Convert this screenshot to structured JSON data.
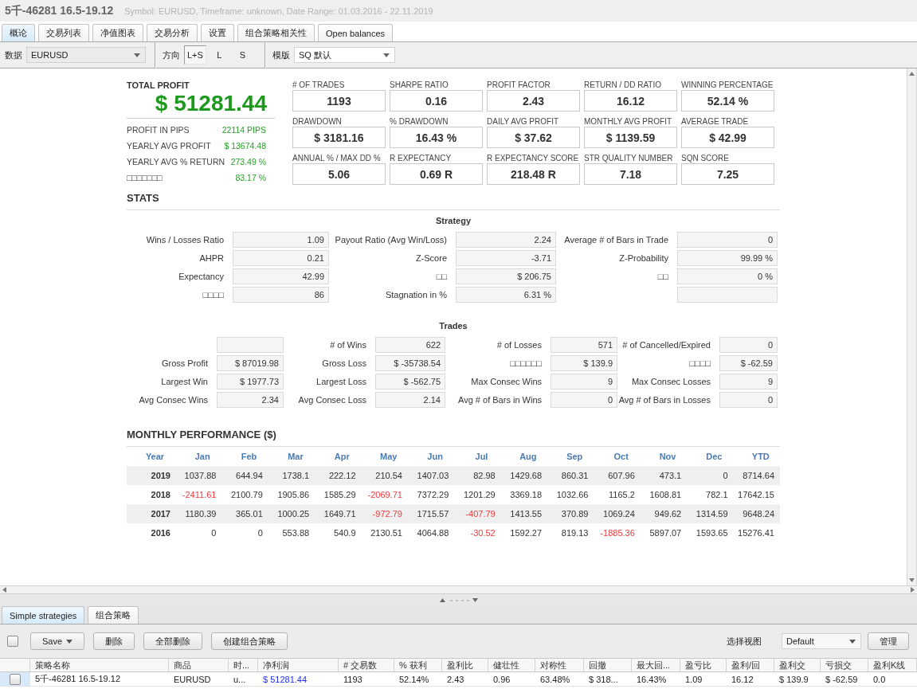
{
  "window": {
    "title": "5千-46281 16.5-19.12",
    "subtitle": "Symbol: EURUSD, Timeframe: unknown, Date Range: 01.03.2016 - 22.11.2019"
  },
  "tabs": [
    {
      "label": "概论",
      "selected": true
    },
    {
      "label": "交易列表",
      "selected": false
    },
    {
      "label": "净值图表",
      "selected": false
    },
    {
      "label": "交易分析",
      "selected": false
    },
    {
      "label": "设置",
      "selected": false
    },
    {
      "label": "组合策略相关性",
      "selected": false
    },
    {
      "label": "Open balances",
      "selected": false
    }
  ],
  "toolbar": {
    "data_label": "数据",
    "data_value": "EURUSD",
    "direction_label": "方向",
    "directions": [
      {
        "label": "L+S",
        "selected": true
      },
      {
        "label": "L",
        "selected": false
      },
      {
        "label": "S",
        "selected": false
      }
    ],
    "template_label": "模版",
    "template_value": "SQ 默认"
  },
  "summary": {
    "total_profit_label": "TOTAL PROFIT",
    "total_profit": "$ 51281.44",
    "details": [
      {
        "label": "PROFIT IN PIPS",
        "value": "22114 PIPS"
      },
      {
        "label": "YEARLY AVG PROFIT",
        "value": "$ 13674.48"
      },
      {
        "label": "YEARLY AVG % RETURN",
        "value": "273.49 %"
      },
      {
        "label": "□□□□□□□",
        "value": "83.17 %"
      }
    ]
  },
  "metrics": [
    {
      "label": "# OF TRADES",
      "value": "1193"
    },
    {
      "label": "SHARPE RATIO",
      "value": "0.16"
    },
    {
      "label": "PROFIT FACTOR",
      "value": "2.43"
    },
    {
      "label": "RETURN / DD RATIO",
      "value": "16.12"
    },
    {
      "label": "WINNING PERCENTAGE",
      "value": "52.14 %"
    },
    {
      "label": "DRAWDOWN",
      "value": "$ 3181.16"
    },
    {
      "label": "% DRAWDOWN",
      "value": "16.43 %"
    },
    {
      "label": "DAILY AVG PROFIT",
      "value": "$ 37.62"
    },
    {
      "label": "MONTHLY AVG PROFIT",
      "value": "$ 1139.59"
    },
    {
      "label": "AVERAGE TRADE",
      "value": "$ 42.99"
    },
    {
      "label": "ANNUAL % / MAX DD %",
      "value": "5.06"
    },
    {
      "label": "R EXPECTANCY",
      "value": "0.69 R"
    },
    {
      "label": "R EXPECTANCY SCORE",
      "value": "218.48 R"
    },
    {
      "label": "STR QUALITY NUMBER",
      "value": "7.18"
    },
    {
      "label": "SQN SCORE",
      "value": "7.25"
    }
  ],
  "stats": {
    "title": "STATS",
    "sections": [
      {
        "title": "Strategy",
        "rows": [
          [
            {
              "kind": "field",
              "label": "Wins / Losses Ratio",
              "value": "1.09"
            },
            {
              "kind": "field",
              "label": "Payout Ratio (Avg Win/Loss)",
              "value": "2.24"
            },
            {
              "kind": "field",
              "label": "Average # of Bars in Trade",
              "value": "0"
            }
          ],
          [
            {
              "kind": "field",
              "label": "AHPR",
              "value": "0.21"
            },
            {
              "kind": "field",
              "label": "Z-Score",
              "value": "-3.71"
            },
            {
              "kind": "field",
              "label": "Z-Probability",
              "value": "99.99 %"
            }
          ],
          [
            {
              "kind": "field",
              "label": "Expectancy",
              "value": "42.99"
            },
            {
              "kind": "field",
              "label": "□□",
              "value": "$ 206.75"
            },
            {
              "kind": "field",
              "label": "□□",
              "value": "0 %"
            }
          ],
          [
            {
              "kind": "field",
              "label": "□□□□",
              "value": "86"
            },
            {
              "kind": "field",
              "label": "Stagnation in %",
              "value": "6.31 %"
            },
            {
              "kind": "blank"
            }
          ]
        ]
      },
      {
        "title": "Trades",
        "rows": [
          [
            {
              "kind": "blank"
            },
            {
              "kind": "field",
              "label": "# of Wins",
              "value": "622"
            },
            {
              "kind": "field",
              "label": "# of Losses",
              "value": "571"
            },
            {
              "kind": "field",
              "label": "# of Cancelled/Expired",
              "value": "0"
            }
          ],
          [
            {
              "kind": "field",
              "label": "Gross Profit",
              "value": "$ 87019.98"
            },
            {
              "kind": "field",
              "label": "Gross Loss",
              "value": "$ -35738.54"
            },
            {
              "kind": "field",
              "label": "□□□□□□",
              "value": "$ 139.9"
            },
            {
              "kind": "field",
              "label": "□□□□",
              "value": "$ -62.59"
            }
          ],
          [
            {
              "kind": "field",
              "label": "Largest Win",
              "value": "$ 1977.73"
            },
            {
              "kind": "field",
              "label": "Largest Loss",
              "value": "$ -562.75"
            },
            {
              "kind": "field",
              "label": "Max Consec Wins",
              "value": "9"
            },
            {
              "kind": "field",
              "label": "Max Consec Losses",
              "value": "9"
            }
          ],
          [
            {
              "kind": "field",
              "label": "Avg Consec Wins",
              "value": "2.34"
            },
            {
              "kind": "field",
              "label": "Avg Consec Loss",
              "value": "2.14"
            },
            {
              "kind": "field",
              "label": "Avg # of Bars in Wins",
              "value": "0"
            },
            {
              "kind": "field",
              "label": "Avg # of Bars in Losses",
              "value": "0"
            }
          ]
        ]
      }
    ]
  },
  "monthly": {
    "title": "MONTHLY PERFORMANCE ($)",
    "columns": [
      "Year",
      "Jan",
      "Feb",
      "Mar",
      "Apr",
      "May",
      "Jun",
      "Jul",
      "Aug",
      "Sep",
      "Oct",
      "Nov",
      "Dec",
      "YTD"
    ],
    "rows": [
      {
        "cells": [
          {
            "value": "2019",
            "negative": false
          },
          {
            "value": "1037.88",
            "negative": false
          },
          {
            "value": "644.94",
            "negative": false
          },
          {
            "value": "1738.1",
            "negative": false
          },
          {
            "value": "222.12",
            "negative": false
          },
          {
            "value": "210.54",
            "negative": false
          },
          {
            "value": "1407.03",
            "negative": false
          },
          {
            "value": "82.98",
            "negative": false
          },
          {
            "value": "1429.68",
            "negative": false
          },
          {
            "value": "860.31",
            "negative": false
          },
          {
            "value": "607.96",
            "negative": false
          },
          {
            "value": "473.1",
            "negative": false
          },
          {
            "value": "0",
            "negative": false
          },
          {
            "value": "8714.64",
            "negative": false
          }
        ]
      },
      {
        "cells": [
          {
            "value": "2018",
            "negative": false
          },
          {
            "value": "-2411.61",
            "negative": true
          },
          {
            "value": "2100.79",
            "negative": false
          },
          {
            "value": "1905.86",
            "negative": false
          },
          {
            "value": "1585.29",
            "negative": false
          },
          {
            "value": "-2069.71",
            "negative": true
          },
          {
            "value": "7372.29",
            "negative": false
          },
          {
            "value": "1201.29",
            "negative": false
          },
          {
            "value": "3369.18",
            "negative": false
          },
          {
            "value": "1032.66",
            "negative": false
          },
          {
            "value": "1165.2",
            "negative": false
          },
          {
            "value": "1608.81",
            "negative": false
          },
          {
            "value": "782.1",
            "negative": false
          },
          {
            "value": "17642.15",
            "negative": false
          }
        ]
      },
      {
        "cells": [
          {
            "value": "2017",
            "negative": false
          },
          {
            "value": "1180.39",
            "negative": false
          },
          {
            "value": "365.01",
            "negative": false
          },
          {
            "value": "1000.25",
            "negative": false
          },
          {
            "value": "1649.71",
            "negative": false
          },
          {
            "value": "-972.79",
            "negative": true
          },
          {
            "value": "1715.57",
            "negative": false
          },
          {
            "value": "-407.79",
            "negative": true
          },
          {
            "value": "1413.55",
            "negative": false
          },
          {
            "value": "370.89",
            "negative": false
          },
          {
            "value": "1069.24",
            "negative": false
          },
          {
            "value": "949.62",
            "negative": false
          },
          {
            "value": "1314.59",
            "negative": false
          },
          {
            "value": "9648.24",
            "negative": false
          }
        ]
      },
      {
        "cells": [
          {
            "value": "2016",
            "negative": false
          },
          {
            "value": "0",
            "negative": false
          },
          {
            "value": "0",
            "negative": false
          },
          {
            "value": "553.88",
            "negative": false
          },
          {
            "value": "540.9",
            "negative": false
          },
          {
            "value": "2130.51",
            "negative": false
          },
          {
            "value": "4064.88",
            "negative": false
          },
          {
            "value": "-30.52",
            "negative": true
          },
          {
            "value": "1592.27",
            "negative": false
          },
          {
            "value": "819.13",
            "negative": false
          },
          {
            "value": "-1885.36",
            "negative": true
          },
          {
            "value": "5897.07",
            "negative": false
          },
          {
            "value": "1593.65",
            "negative": false
          },
          {
            "value": "15276.41",
            "negative": false
          }
        ]
      }
    ]
  },
  "bottom": {
    "tabs": [
      {
        "label": "Simple strategies",
        "selected": true
      },
      {
        "label": "组合策略",
        "selected": false
      }
    ],
    "select_all": {
      "checked": false
    },
    "buttons": [
      {
        "label": "Save",
        "kind": "menu"
      },
      {
        "label": "删除",
        "kind": "plain"
      },
      {
        "label": "全部删除",
        "kind": "plain"
      },
      {
        "label": "创建组合策略",
        "kind": "plain"
      }
    ],
    "view_label": "选择视图",
    "view_value": "Default",
    "manage_button": "管理",
    "table": {
      "columns": [
        {
          "label": "策略名称",
          "kind": "text"
        },
        {
          "label": "商品",
          "kind": "text"
        },
        {
          "label": "时...",
          "kind": "text"
        },
        {
          "label": "净利润",
          "kind": "profit"
        },
        {
          "label": "# 交易数",
          "kind": "text"
        },
        {
          "label": "% 获利",
          "kind": "text"
        },
        {
          "label": "盈利比",
          "kind": "text"
        },
        {
          "label": "健壮性",
          "kind": "text"
        },
        {
          "label": "对称性",
          "kind": "text"
        },
        {
          "label": "回撤",
          "kind": "text"
        },
        {
          "label": "最大回...",
          "kind": "text"
        },
        {
          "label": "盈亏比",
          "kind": "text"
        },
        {
          "label": "盈利/回",
          "kind": "text"
        },
        {
          "label": "盈利交",
          "kind": "text"
        },
        {
          "label": "亏损交",
          "kind": "text"
        },
        {
          "label": "盈利K线",
          "kind": "text"
        }
      ],
      "rows": [
        {
          "selected": true,
          "checked": false,
          "cells": [
            "5千-46281 16.5-19.12",
            "EURUSD",
            "u...",
            "$ 51281.44",
            "1193",
            "52.14%",
            "2.43",
            "0.96",
            "63.48%",
            "$ 318...",
            "16.43%",
            "1.09",
            "16.12",
            "$ 139.9",
            "$ -62.59",
            "0.0"
          ]
        }
      ]
    }
  }
}
